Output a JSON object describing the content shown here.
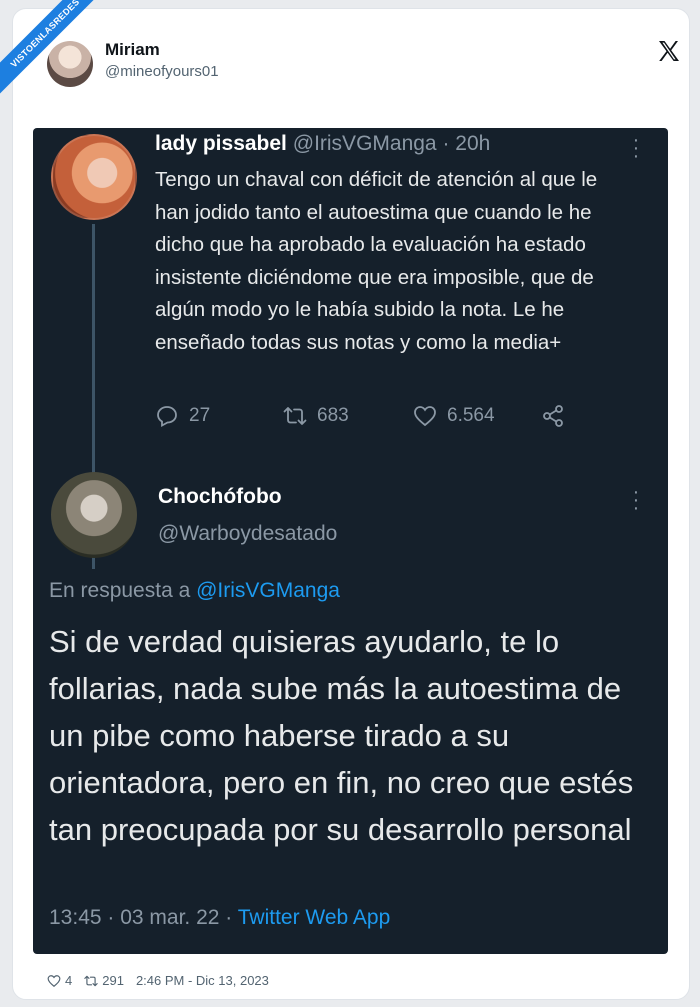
{
  "watermark": "VISTOENLASREDES",
  "outer_tweet": {
    "author_name": "Miriam",
    "author_handle": "@mineofyours01",
    "footer": {
      "likes": "4",
      "retweets": "291",
      "timestamp": "2:46 PM - Dic 13, 2023"
    }
  },
  "screenshot": {
    "tweet1": {
      "name": "lady pissabel",
      "handle": "@IrisVGManga",
      "sep": " · ",
      "time": "20h",
      "text": "Tengo un chaval con déficit de atención al que le han jodido tanto el autoestima que cuando le he dicho que ha aprobado la evaluación ha estado insistente diciéndome que era imposible, que de algún modo yo le había subido la nota. Le he enseñado todas sus notas y como la media+",
      "replies": "27",
      "retweets": "683",
      "likes": "6.564"
    },
    "tweet2": {
      "name": "Chochófobo",
      "handle": "@Warboydesatado",
      "reply_prefix": "En respuesta a ",
      "reply_to": "@IrisVGManga",
      "text": "Si de verdad quisieras ayudarlo, te lo follarias, nada sube más la autoestima de un pibe como haberse tirado a su orientadora, pero en fin, no creo que estés tan preocupada por su desarrollo personal",
      "meta": "13:45 · 03 mar. 22 · ",
      "app": "Twitter Web App"
    }
  },
  "icons": {
    "brand": "x-logo-icon",
    "reply": "reply-icon",
    "retweet": "retweet-icon",
    "like": "heart-icon",
    "share": "share-icon",
    "more": "more-vertical-icon"
  },
  "colors": {
    "dark_bg": "#15202b",
    "link": "#1d9bf0",
    "muted": "#8b98a5",
    "ribbon": "#1d7fe0"
  }
}
